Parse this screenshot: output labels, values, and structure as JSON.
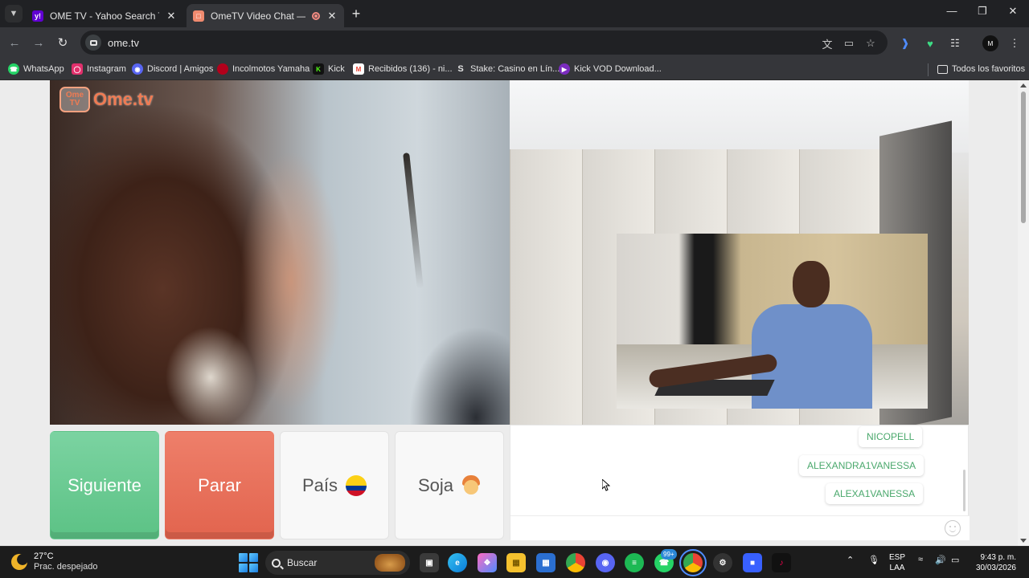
{
  "browser": {
    "tabs": [
      {
        "title": "OME TV - Yahoo Search Tus re",
        "favicon": "yahoo-favicon",
        "active": false
      },
      {
        "title": "OmeTV Video Chat — Alter",
        "favicon": "ometv-favicon",
        "active": true,
        "recording": true
      }
    ],
    "url": "ome.tv",
    "bookmarks": [
      {
        "label": "WhatsApp",
        "icon": "whatsapp-icon",
        "color": "#25d366"
      },
      {
        "label": "Instagram",
        "icon": "instagram-icon",
        "color": "#e1306c"
      },
      {
        "label": "Discord | Amigos",
        "icon": "discord-icon",
        "color": "#5865f2"
      },
      {
        "label": "Incolmotos Yamaha",
        "icon": "yamaha-icon",
        "color": "#b3001b"
      },
      {
        "label": "Kick",
        "icon": "kick-icon",
        "color": "#53fc18"
      },
      {
        "label": "Recibidos (136) - ni...",
        "icon": "gmail-icon",
        "color": "#ea4335"
      },
      {
        "label": "Stake: Casino en Lín...",
        "icon": "stake-icon",
        "color": "#1a2c38"
      },
      {
        "label": "Kick VOD Download...",
        "icon": "kick-vod-icon",
        "color": "#7b2cbf"
      }
    ],
    "all_bookmarks_label": "Todos los favoritos",
    "profile_initials": "M"
  },
  "ometv": {
    "logo_badge": "Ome TV",
    "logo_text": "Ome.tv",
    "buttons": {
      "next": "Siguiente",
      "stop": "Parar",
      "country": "País",
      "gender": "Soja"
    },
    "country_flag": "colombia-flag",
    "gender_icon": "boy-emoji",
    "chat_messages": [
      "NICOPELL",
      "ALEXANDRA1VANESSA",
      "ALEXA1VANESSA"
    ],
    "chat_input_placeholder": ""
  },
  "taskbar": {
    "weather_temp": "27°C",
    "weather_condition": "Prac. despejado",
    "search_label": "Buscar",
    "notification_badge": "99+",
    "lang_line1": "ESP",
    "lang_line2": "LAA",
    "time": "9:43 p. m.",
    "date": "30/03/2026"
  }
}
